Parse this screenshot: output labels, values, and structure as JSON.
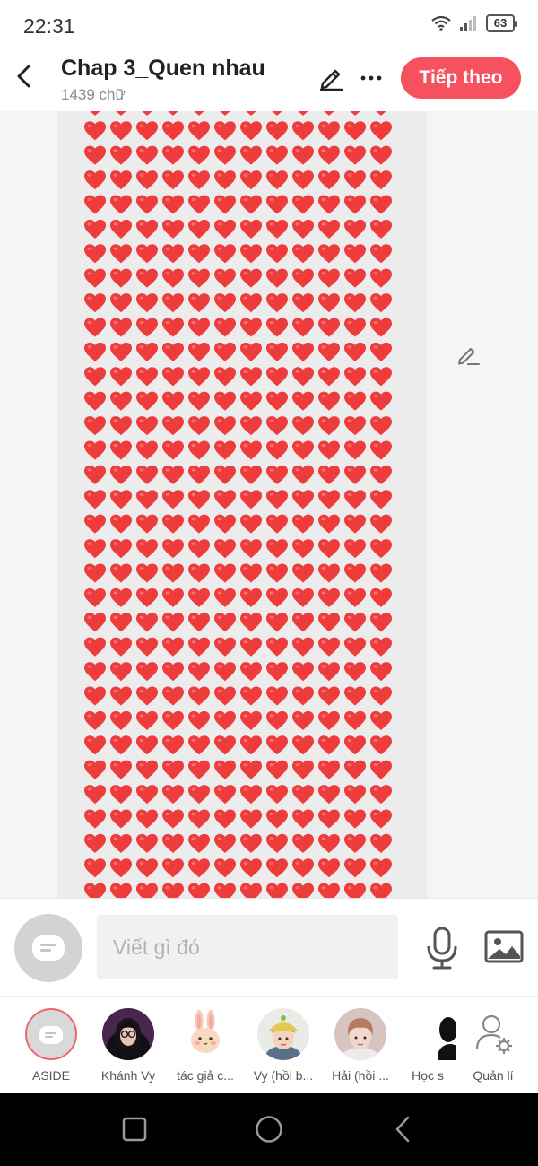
{
  "status_bar": {
    "time": "22:31",
    "battery": "63",
    "icons": [
      "wifi-icon",
      "signal-icon",
      "battery-icon"
    ]
  },
  "header": {
    "title": "Chap 3_Quen nhau",
    "word_count": "1439 chữ",
    "next_button": "Tiếp theo",
    "accent_color": "#f5515f",
    "icons": [
      "back-arrow-icon",
      "pencil-icon",
      "more-dots-icon"
    ]
  },
  "content": {
    "image_description_icon": "red-heart-emoji",
    "heart_color": "#ee3b3b"
  },
  "composer": {
    "placeholder": "Viết gì đó",
    "icons": [
      "chat-bubble-icon",
      "microphone-icon",
      "image-icon"
    ]
  },
  "participants": [
    {
      "name": "ASIDE",
      "avatar": "chat-bubble-icon"
    },
    {
      "name": "Khánh Vy",
      "avatar": "girl-with-glasses"
    },
    {
      "name": "tác giả c...",
      "avatar": "bunny"
    },
    {
      "name": "Vy (hồi b...",
      "avatar": "child-with-hat"
    },
    {
      "name": "Hải (hồi ...",
      "avatar": "young-man"
    },
    {
      "name": "Học s",
      "avatar": "silhouette"
    },
    {
      "name": "Quản lí",
      "avatar": "user-settings-icon"
    }
  ],
  "nav_bar": {
    "icons": [
      "recent-apps-icon",
      "home-icon",
      "back-icon"
    ]
  }
}
